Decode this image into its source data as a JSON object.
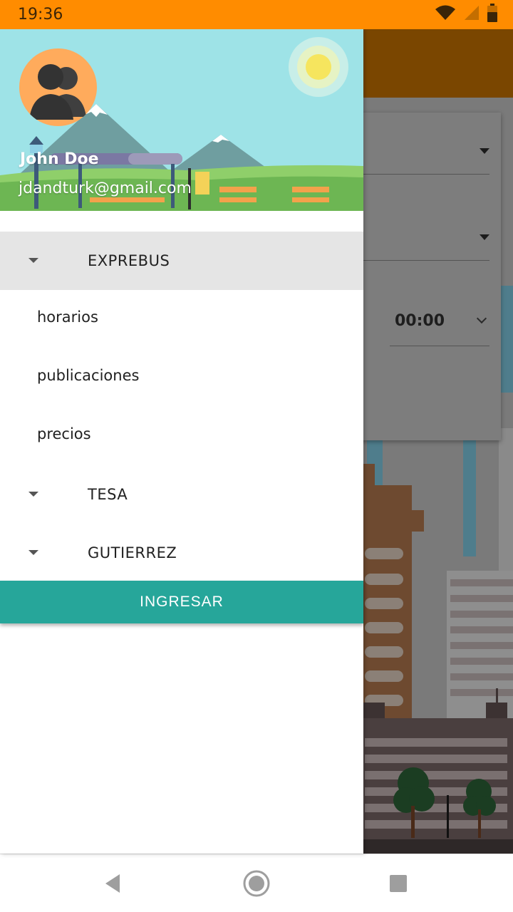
{
  "status_bar": {
    "time": "19:36",
    "icons": [
      "wifi-icon",
      "signal-icon",
      "battery-icon"
    ],
    "color": "#ff8c00"
  },
  "background_app": {
    "time_value": "00:00",
    "toolbar_color": "#7a4600"
  },
  "drawer": {
    "header": {
      "user_name": "John Doe",
      "user_email": "jdandturk@gmail.com",
      "avatar_icon": "user-group-icon"
    },
    "menu": [
      {
        "label": "EXPREBUS",
        "expanded": true,
        "selected": true,
        "items": [
          "horarios",
          "publicaciones",
          "precios"
        ]
      },
      {
        "label": "TESA",
        "expanded": false,
        "selected": false,
        "items": []
      },
      {
        "label": "GUTIERREZ",
        "expanded": false,
        "selected": false,
        "items": []
      }
    ],
    "login_button": "INGRESAR",
    "accent_color": "#26a69a"
  },
  "nav_bar": {
    "buttons": [
      "back-icon",
      "home-icon",
      "recents-icon"
    ]
  }
}
